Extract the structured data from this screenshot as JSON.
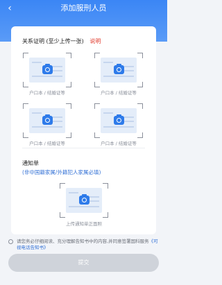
{
  "header": {
    "back_icon": "chevron-left-icon",
    "title": "添加服刑人员"
  },
  "relation": {
    "title": "关系证明 (至少上传一张)",
    "explain_link": "说明",
    "slots": [
      {
        "label": "户口本 / 结婚证等",
        "icon": "camera-icon"
      },
      {
        "label": "户口本 / 结婚证等",
        "icon": "camera-icon"
      },
      {
        "label": "户口本 / 结婚证等",
        "icon": "camera-icon"
      },
      {
        "label": "户口本 / 结婚证等",
        "icon": "camera-icon"
      }
    ]
  },
  "notice": {
    "title": "通知单",
    "subtitle": "(非中国籍家属/外籍犯人家属必填)",
    "slot_label": "上传通知单正面照"
  },
  "agreement": {
    "text": "请您务必仔细阅读、充分理解告知书中的内容,并同意签署国科服务",
    "link": "《可视电话告知书》"
  },
  "submit_label": "提交",
  "colors": {
    "primary": "#3b86f5",
    "explain": "#e0392b",
    "link": "#3472d6",
    "submit_disabled": "#cfd3da"
  }
}
